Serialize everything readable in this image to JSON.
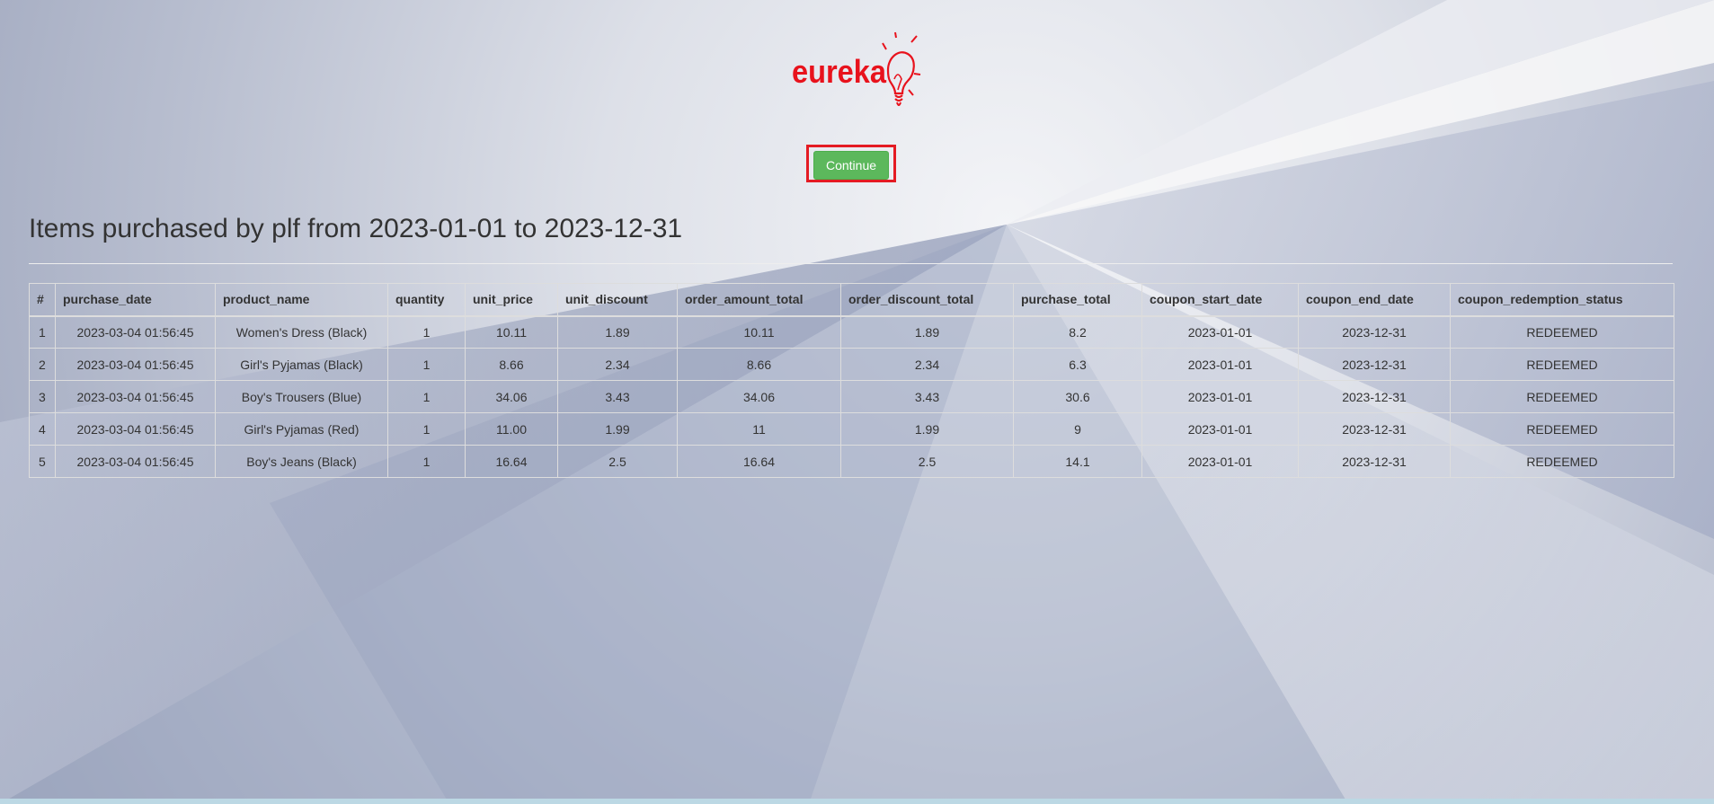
{
  "logo": {
    "text": "eureka",
    "brand_color": "#e8121c"
  },
  "continue_button": {
    "label": "Continue",
    "button_color": "#5cb85c",
    "highlight_color": "#e41b23"
  },
  "heading": "Items purchased by plf from 2023-01-01 to 2023-12-31",
  "table": {
    "columns": [
      "#",
      "purchase_date",
      "product_name",
      "quantity",
      "unit_price",
      "unit_discount",
      "order_amount_total",
      "order_discount_total",
      "purchase_total",
      "coupon_start_date",
      "coupon_end_date",
      "coupon_redemption_status"
    ],
    "rows": [
      [
        "1",
        "2023-03-04 01:56:45",
        "Women's Dress (Black)",
        "1",
        "10.11",
        "1.89",
        "10.11",
        "1.89",
        "8.2",
        "2023-01-01",
        "2023-12-31",
        "REDEEMED"
      ],
      [
        "2",
        "2023-03-04 01:56:45",
        "Girl's Pyjamas (Black)",
        "1",
        "8.66",
        "2.34",
        "8.66",
        "2.34",
        "6.3",
        "2023-01-01",
        "2023-12-31",
        "REDEEMED"
      ],
      [
        "3",
        "2023-03-04 01:56:45",
        "Boy's Trousers (Blue)",
        "1",
        "34.06",
        "3.43",
        "34.06",
        "3.43",
        "30.6",
        "2023-01-01",
        "2023-12-31",
        "REDEEMED"
      ],
      [
        "4",
        "2023-03-04 01:56:45",
        "Girl's Pyjamas (Red)",
        "1",
        "11.00",
        "1.99",
        "11",
        "1.99",
        "9",
        "2023-01-01",
        "2023-12-31",
        "REDEEMED"
      ],
      [
        "5",
        "2023-03-04 01:56:45",
        "Boy's Jeans (Black)",
        "1",
        "16.64",
        "2.5",
        "16.64",
        "2.5",
        "14.1",
        "2023-01-01",
        "2023-12-31",
        "REDEEMED"
      ]
    ]
  }
}
